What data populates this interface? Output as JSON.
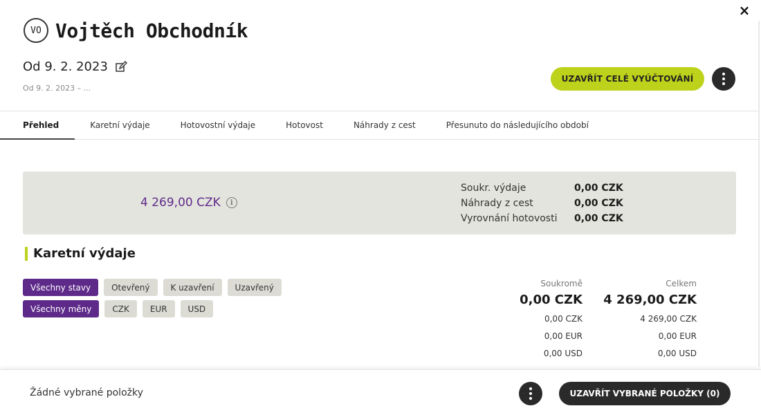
{
  "window": {
    "close_label": "×"
  },
  "header": {
    "avatar_initials": "VO",
    "name": "Vojtěch Obchodník",
    "period_title": "Od 9. 2. 2023",
    "period_sub": "Od 9. 2. 2023 – ...",
    "close_all_label": "UZAVŘÍT CELÉ VYÚČTOVÁNÍ"
  },
  "tabs": [
    {
      "label": "Přehled",
      "active": true
    },
    {
      "label": "Karetní výdaje"
    },
    {
      "label": "Hotovostní výdaje"
    },
    {
      "label": "Hotovost"
    },
    {
      "label": "Náhrady z cest"
    },
    {
      "label": "Přesunuto do následujícího období"
    }
  ],
  "summary": {
    "total": "4 269,00 CZK",
    "info_glyph": "i",
    "rows": [
      {
        "label": "Soukr. výdaje",
        "value": "0,00 CZK"
      },
      {
        "label": "Náhrady z cest",
        "value": "0,00 CZK"
      },
      {
        "label": "Vyrovnání hotovosti",
        "value": "0,00 CZK"
      }
    ]
  },
  "card_expenses": {
    "title": "Karetní výdaje",
    "status_filters": [
      "Všechny stavy",
      "Otevřený",
      "K uzavření",
      "Uzavřený"
    ],
    "currency_filters": [
      "Všechny měny",
      "CZK",
      "EUR",
      "USD"
    ],
    "private": {
      "header": "Soukromě",
      "total": "0,00 CZK",
      "lines": [
        "0,00 CZK",
        "0,00 EUR",
        "0,00 USD"
      ]
    },
    "overall": {
      "header": "Celkem",
      "total": "4 269,00 CZK",
      "lines": [
        "4 269,00 CZK",
        "0,00 EUR",
        "0,00 USD"
      ]
    }
  },
  "footer": {
    "selection_text": "Žádné vybrané položky",
    "close_selected_label": "UZAVŘÍT VYBRANÉ POLOŽKY (0)"
  },
  "colors": {
    "accent_green": "#bdd21a",
    "accent_purple": "#5e2a8a",
    "dark": "#2a2a2a"
  },
  "icons": {
    "close": "close-icon",
    "edit": "edit-icon",
    "info": "info-icon",
    "more": "more-vertical-icon"
  }
}
